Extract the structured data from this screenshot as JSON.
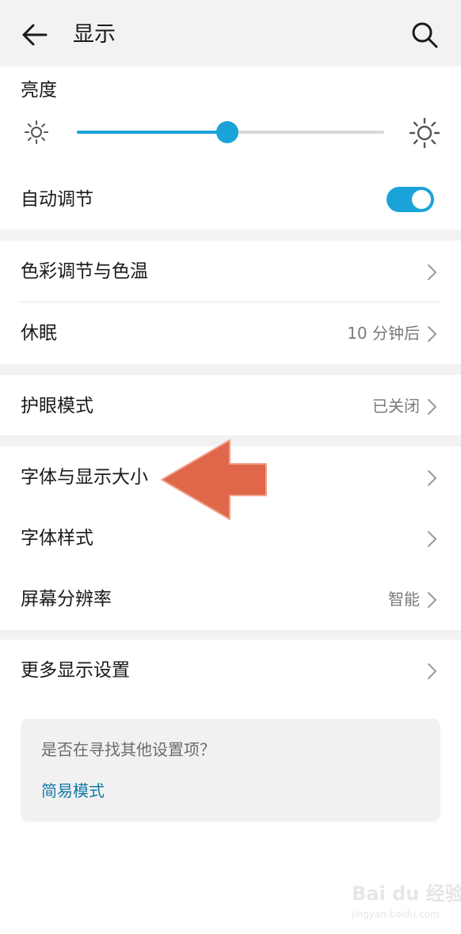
{
  "header": {
    "title": "显示"
  },
  "brightness": {
    "label": "亮度",
    "level_percent": 49
  },
  "auto_adjust": {
    "label": "自动调节",
    "enabled": true
  },
  "groups": {
    "color": {
      "label": "色彩调节与色温"
    },
    "sleep": {
      "label": "休眠",
      "value": "10 分钟后"
    },
    "eye": {
      "label": "护眼模式",
      "value": "已关闭"
    },
    "font_size": {
      "label": "字体与显示大小"
    },
    "font_style": {
      "label": "字体样式"
    },
    "resolution": {
      "label": "屏幕分辨率",
      "value": "智能"
    },
    "more": {
      "label": "更多显示设置"
    }
  },
  "suggestion": {
    "question": "是否在寻找其他设置项？",
    "link": "简易模式"
  },
  "colors": {
    "accent": "#1aa3d9",
    "annotation_arrow": "#e0674a",
    "link": "#1679a8"
  },
  "watermark": {
    "logo_text": "Bai du 经验",
    "url": "jingyan.baidu.com"
  }
}
